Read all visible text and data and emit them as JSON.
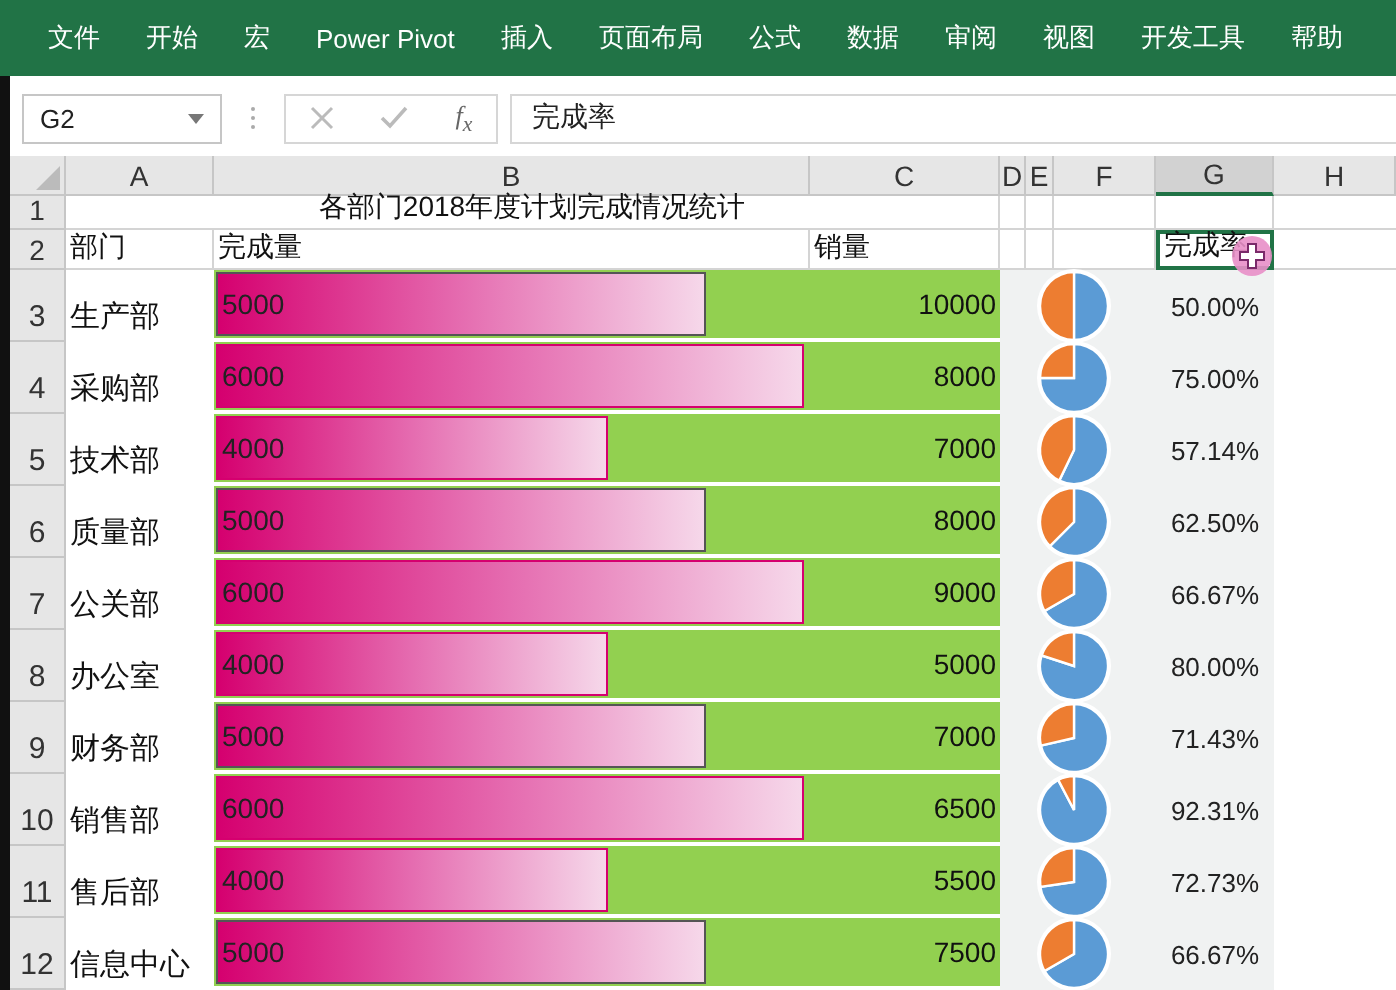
{
  "ribbon_tabs": [
    {
      "label": "文件"
    },
    {
      "label": "开始"
    },
    {
      "label": "宏"
    },
    {
      "label": "Power Pivot"
    },
    {
      "label": "插入"
    },
    {
      "label": "页面布局"
    },
    {
      "label": "公式"
    },
    {
      "label": "数据"
    },
    {
      "label": "审阅"
    },
    {
      "label": "视图"
    },
    {
      "label": "开发工具"
    },
    {
      "label": "帮助"
    }
  ],
  "name_box": "G2",
  "fx_label": "f$_{x}$",
  "formula": "完成率",
  "columns": [
    {
      "label": "A",
      "selected": false
    },
    {
      "label": "B",
      "selected": false
    },
    {
      "label": "C",
      "selected": false
    },
    {
      "label": "D",
      "selected": false
    },
    {
      "label": "E",
      "selected": false
    },
    {
      "label": "F",
      "selected": false
    },
    {
      "label": "G",
      "selected": true
    },
    {
      "label": "H",
      "selected": false
    }
  ],
  "title_row": {
    "number": "1",
    "title": "各部门2018年度计划完成情况统计"
  },
  "header_row": {
    "number": "2",
    "cells": [
      {
        "text": "部门",
        "selected": false
      },
      {
        "text": "完成量",
        "selected": false
      },
      {
        "text": "销量",
        "selected": false
      },
      {
        "text": "完成率",
        "selected": true
      }
    ]
  },
  "rows": [
    {
      "number": "3",
      "dept": "生产部",
      "done": "5000",
      "bar": {
        "level": 0.833
      },
      "sales": "10000",
      "pie": {
        "chart_data": {
          "type": "pie",
          "values": [
            50,
            50
          ]
        }
      },
      "rate": "50.00%"
    },
    {
      "number": "4",
      "dept": "采购部",
      "done": "6000",
      "bar": {
        "level": 1
      },
      "sales": "8000",
      "pie": {
        "chart_data": {
          "type": "pie",
          "values": [
            75,
            25
          ]
        }
      },
      "rate": "75.00%"
    },
    {
      "number": "5",
      "dept": "技术部",
      "done": "4000",
      "bar": {
        "level": 0.667
      },
      "sales": "7000",
      "pie": {
        "chart_data": {
          "type": "pie",
          "values": [
            57.14,
            42.86
          ]
        }
      },
      "rate": "57.14%"
    },
    {
      "number": "6",
      "dept": "质量部",
      "done": "5000",
      "bar": {
        "level": 0.833
      },
      "sales": "8000",
      "pie": {
        "chart_data": {
          "type": "pie",
          "values": [
            62.5,
            37.5
          ]
        }
      },
      "rate": "62.50%"
    },
    {
      "number": "7",
      "dept": "公关部",
      "done": "6000",
      "bar": {
        "level": 1
      },
      "sales": "9000",
      "pie": {
        "chart_data": {
          "type": "pie",
          "values": [
            66.67,
            33.33
          ]
        }
      },
      "rate": "66.67%"
    },
    {
      "number": "8",
      "dept": "办公室",
      "done": "4000",
      "bar": {
        "level": 0.667
      },
      "sales": "5000",
      "pie": {
        "chart_data": {
          "type": "pie",
          "values": [
            80,
            20
          ]
        }
      },
      "rate": "80.00%"
    },
    {
      "number": "9",
      "dept": "财务部",
      "done": "5000",
      "bar": {
        "level": 0.833
      },
      "sales": "7000",
      "pie": {
        "chart_data": {
          "type": "pie",
          "values": [
            71.43,
            28.57
          ]
        }
      },
      "rate": "71.43%"
    },
    {
      "number": "10",
      "dept": "销售部",
      "done": "6000",
      "bar": {
        "level": 1
      },
      "sales": "6500",
      "pie": {
        "chart_data": {
          "type": "pie",
          "values": [
            92.31,
            7.69
          ]
        }
      },
      "rate": "92.31%"
    },
    {
      "number": "11",
      "dept": "售后部",
      "done": "4000",
      "bar": {
        "level": 0.667
      },
      "sales": "5500",
      "pie": {
        "chart_data": {
          "type": "pie",
          "values": [
            72.73,
            27.27
          ]
        }
      },
      "rate": "72.73%"
    },
    {
      "number": "12",
      "dept": "信息中心",
      "done": "5000",
      "bar": {
        "level": 0.833
      },
      "sales": "7500",
      "pie": {
        "chart_data": {
          "type": "pie",
          "values": [
            66.67,
            33.33
          ]
        }
      },
      "rate": "66.67%"
    }
  ]
}
